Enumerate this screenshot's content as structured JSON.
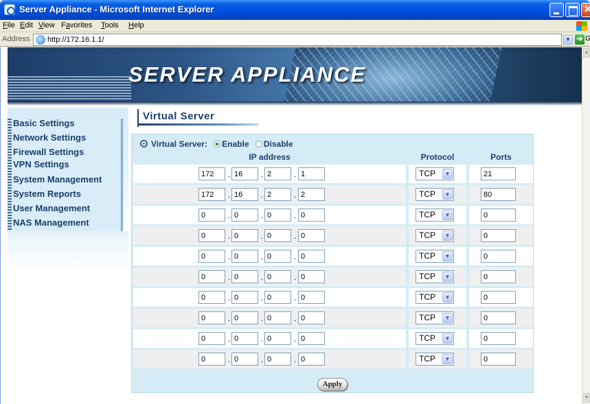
{
  "window": {
    "title": "Server Appliance - Microsoft Internet Explorer"
  },
  "menu": [
    {
      "key": "F",
      "rest": "ile"
    },
    {
      "key": "E",
      "rest": "dit"
    },
    {
      "key": "V",
      "rest": "iew"
    },
    {
      "pre": "F",
      "key": "a",
      "rest": "vorites"
    },
    {
      "key": "T",
      "rest": "ools"
    },
    {
      "key": "H",
      "rest": "elp"
    }
  ],
  "address": {
    "label": "Address",
    "url": "http://172.16.1.1/",
    "go_label": "Go"
  },
  "banner": {
    "title": "SERVER APPLIANCE"
  },
  "nav": {
    "items": [
      {
        "label": "Basic Settings"
      },
      {
        "label": "Network Settings"
      },
      {
        "label": "Firewall Settings"
      },
      {
        "label": "VPN Settings"
      },
      {
        "label": "System Management"
      },
      {
        "label": "System Reports"
      },
      {
        "label": "User Management"
      },
      {
        "label": "NAS Management"
      }
    ]
  },
  "section": {
    "title": "Virtual Server"
  },
  "form": {
    "virtual_server_label": "Virtual Server:",
    "enable_label": "Enable",
    "disable_label": "Disable",
    "selected": "Enable",
    "columns": {
      "ip": "IP address",
      "protocol": "Protocol",
      "ports": "Ports"
    },
    "rows": [
      {
        "ip": [
          "172",
          "16",
          "2",
          "1"
        ],
        "protocol": "TCP",
        "port": "21"
      },
      {
        "ip": [
          "172",
          "16",
          "2",
          "2"
        ],
        "protocol": "TCP",
        "port": "80"
      },
      {
        "ip": [
          "0",
          "0",
          "0",
          "0"
        ],
        "protocol": "TCP",
        "port": "0"
      },
      {
        "ip": [
          "0",
          "0",
          "0",
          "0"
        ],
        "protocol": "TCP",
        "port": "0"
      },
      {
        "ip": [
          "0",
          "0",
          "0",
          "0"
        ],
        "protocol": "TCP",
        "port": "0"
      },
      {
        "ip": [
          "0",
          "0",
          "0",
          "0"
        ],
        "protocol": "TCP",
        "port": "0"
      },
      {
        "ip": [
          "0",
          "0",
          "0",
          "0"
        ],
        "protocol": "TCP",
        "port": "0"
      },
      {
        "ip": [
          "0",
          "0",
          "0",
          "0"
        ],
        "protocol": "TCP",
        "port": "0"
      },
      {
        "ip": [
          "0",
          "0",
          "0",
          "0"
        ],
        "protocol": "TCP",
        "port": "0"
      },
      {
        "ip": [
          "0",
          "0",
          "0",
          "0"
        ],
        "protocol": "TCP",
        "port": "0"
      }
    ],
    "apply_label": "Apply"
  },
  "colors": {
    "nav_text": "#1c3e6b",
    "form_bg": "#d5ecf6",
    "titlebar_blue": "#0054e3"
  }
}
